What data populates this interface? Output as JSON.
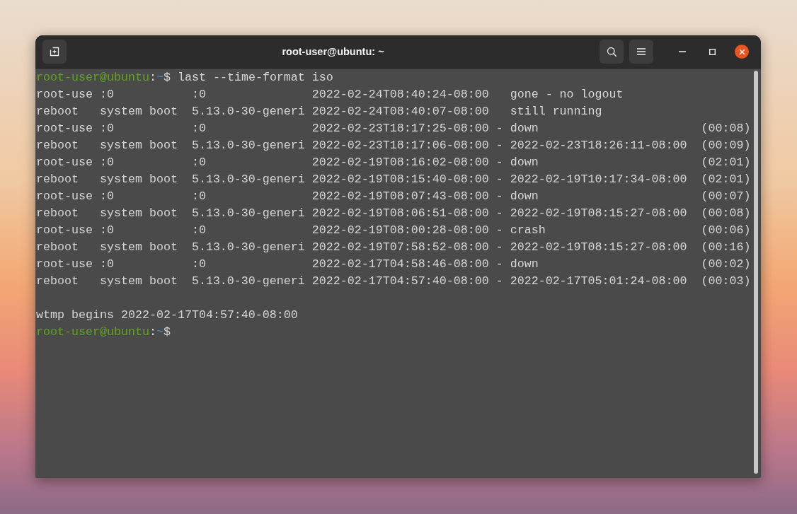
{
  "window": {
    "title": "root-user@ubuntu: ~"
  },
  "terminal": {
    "lines": [
      {
        "kind": "prompt",
        "user_host": "root-user@ubuntu",
        "colon": ":",
        "path": "~",
        "symbol": "$",
        "command": "last --time-format iso"
      },
      {
        "kind": "record",
        "user": "root-use",
        "tty": ":0",
        "host": ":0",
        "login": "2022-02-24T08:40:24-08:00",
        "logout": "gone - no logout"
      },
      {
        "kind": "record",
        "user": "reboot",
        "tty": "system boot",
        "host": "5.13.0-30-generi",
        "login": "2022-02-24T08:40:07-08:00",
        "logout": "still running"
      },
      {
        "kind": "record",
        "user": "root-use",
        "tty": ":0",
        "host": ":0",
        "login": "2022-02-23T18:17:25-08:00",
        "sep": "-",
        "logout": "down",
        "duration": "(00:08)"
      },
      {
        "kind": "record",
        "user": "reboot",
        "tty": "system boot",
        "host": "5.13.0-30-generi",
        "login": "2022-02-23T18:17:06-08:00",
        "sep": "-",
        "logout": "2022-02-23T18:26:11-08:00",
        "duration": "(00:09)"
      },
      {
        "kind": "record",
        "user": "root-use",
        "tty": ":0",
        "host": ":0",
        "login": "2022-02-19T08:16:02-08:00",
        "sep": "-",
        "logout": "down",
        "duration": "(02:01)"
      },
      {
        "kind": "record",
        "user": "reboot",
        "tty": "system boot",
        "host": "5.13.0-30-generi",
        "login": "2022-02-19T08:15:40-08:00",
        "sep": "-",
        "logout": "2022-02-19T10:17:34-08:00",
        "duration": "(02:01)"
      },
      {
        "kind": "record",
        "user": "root-use",
        "tty": ":0",
        "host": ":0",
        "login": "2022-02-19T08:07:43-08:00",
        "sep": "-",
        "logout": "down",
        "duration": "(00:07)"
      },
      {
        "kind": "record",
        "user": "reboot",
        "tty": "system boot",
        "host": "5.13.0-30-generi",
        "login": "2022-02-19T08:06:51-08:00",
        "sep": "-",
        "logout": "2022-02-19T08:15:27-08:00",
        "duration": "(00:08)"
      },
      {
        "kind": "record",
        "user": "root-use",
        "tty": ":0",
        "host": ":0",
        "login": "2022-02-19T08:00:28-08:00",
        "sep": "-",
        "logout": "crash",
        "duration": "(00:06)"
      },
      {
        "kind": "record",
        "user": "reboot",
        "tty": "system boot",
        "host": "5.13.0-30-generi",
        "login": "2022-02-19T07:58:52-08:00",
        "sep": "-",
        "logout": "2022-02-19T08:15:27-08:00",
        "duration": "(00:16)"
      },
      {
        "kind": "record",
        "user": "root-use",
        "tty": ":0",
        "host": ":0",
        "login": "2022-02-17T04:58:46-08:00",
        "sep": "-",
        "logout": "down",
        "duration": "(00:02)"
      },
      {
        "kind": "record",
        "user": "reboot",
        "tty": "system boot",
        "host": "5.13.0-30-generi",
        "login": "2022-02-17T04:57:40-08:00",
        "sep": "-",
        "logout": "2022-02-17T05:01:24-08:00",
        "duration": "(00:03)"
      },
      {
        "kind": "blank"
      },
      {
        "kind": "text",
        "text": "wtmp begins 2022-02-17T04:57:40-08:00"
      },
      {
        "kind": "prompt",
        "user_host": "root-user@ubuntu",
        "colon": ":",
        "path": "~",
        "symbol": "$"
      }
    ]
  }
}
